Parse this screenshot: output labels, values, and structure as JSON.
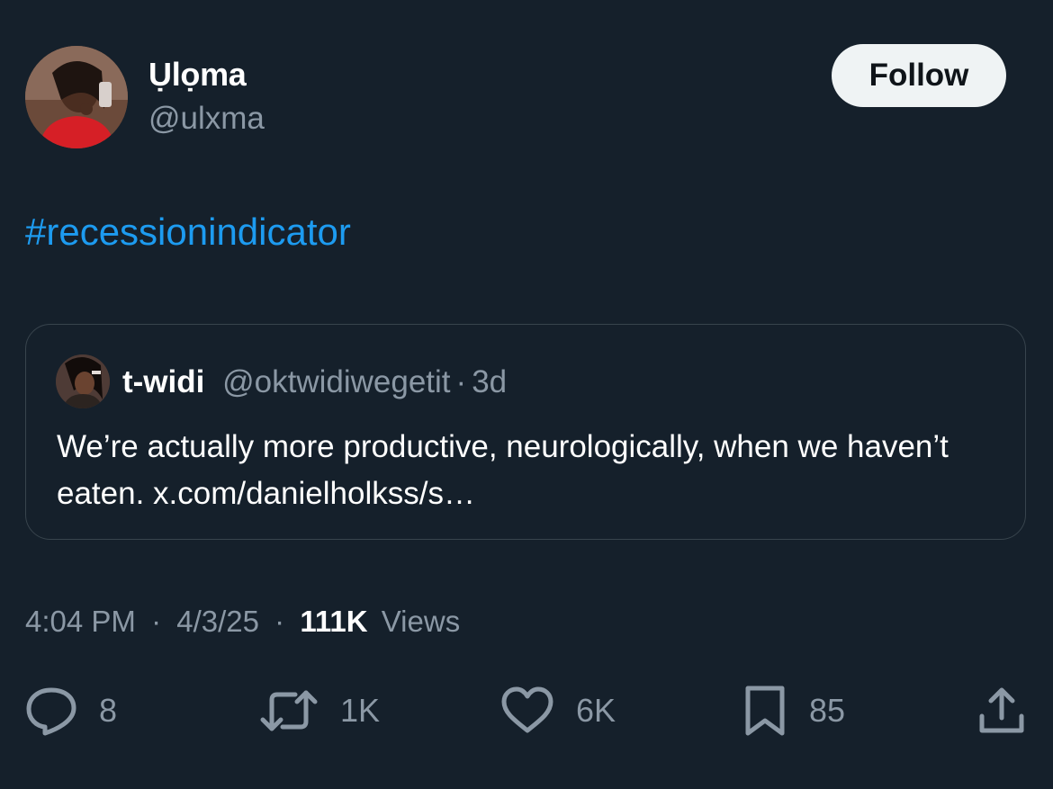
{
  "author": {
    "display_name": "Ụlọma",
    "handle": "@ulxma"
  },
  "follow_button": {
    "label": "Follow"
  },
  "tweet": {
    "text": "#recessionindicator"
  },
  "quoted_tweet": {
    "display_name": "t-widi",
    "handle": "@oktwidiwegetit",
    "separator": "·",
    "time": "3d",
    "text": "We’re actually more productive, neurologically, when we haven’t eaten. x.com/danielholkss/s…"
  },
  "meta": {
    "time": "4:04 PM",
    "separator": "·",
    "date": "4/3/25",
    "views_count": "111K",
    "views_label": "Views"
  },
  "actions": {
    "replies": {
      "icon": "reply-icon",
      "count": "8"
    },
    "reposts": {
      "icon": "repost-icon",
      "count": "1K"
    },
    "likes": {
      "icon": "heart-icon",
      "count": "6K"
    },
    "bookmarks": {
      "icon": "bookmark-icon",
      "count": "85"
    },
    "share": {
      "icon": "share-icon"
    }
  },
  "colors": {
    "background": "#15202b",
    "accent": "#1d9bf0",
    "secondary_text": "#8b98a5",
    "border": "#38444d"
  }
}
